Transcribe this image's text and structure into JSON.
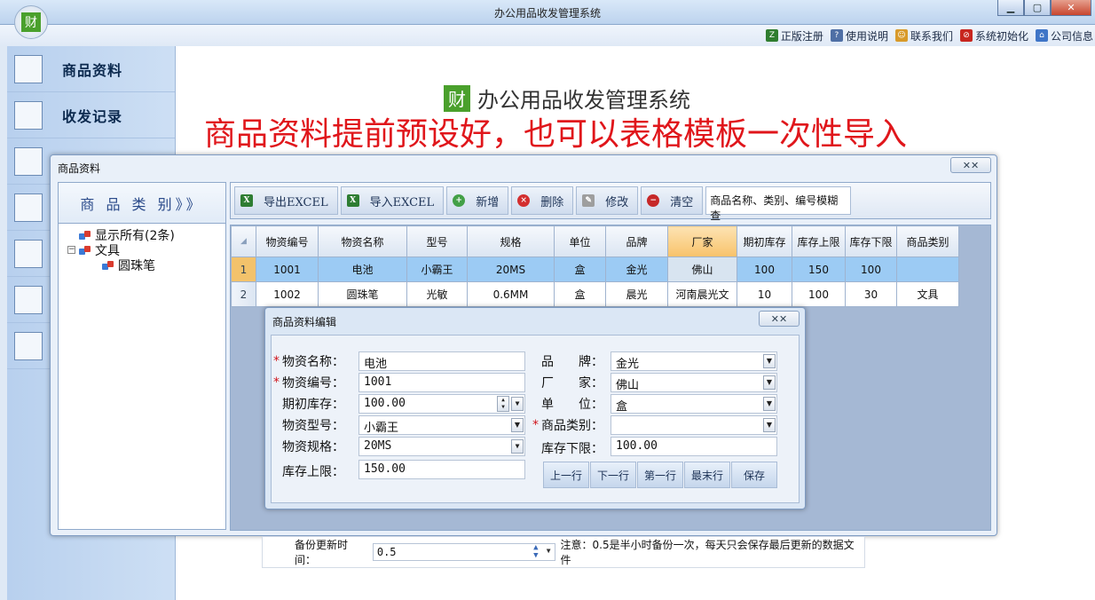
{
  "window": {
    "title": "办公用品收发管理系统",
    "min": "▁",
    "max": "▢",
    "close": "✕",
    "logo_char": "财"
  },
  "toplinks": [
    {
      "label": "正版注册",
      "icon": "register-icon",
      "color": "#2f7d2f",
      "glyph": "Z"
    },
    {
      "label": "使用说明",
      "icon": "book-icon",
      "color": "#4f6fa5",
      "glyph": "?"
    },
    {
      "label": "联系我们",
      "icon": "contact-icon",
      "color": "#d89a2a",
      "glyph": "☺"
    },
    {
      "label": "系统初始化",
      "icon": "reset-icon",
      "color": "#c8261f",
      "glyph": "⊘"
    },
    {
      "label": "公司信息",
      "icon": "company-icon",
      "color": "#3f75c7",
      "glyph": "⌂"
    }
  ],
  "nav": [
    {
      "label": "商品资料",
      "icon": "shop-icon"
    },
    {
      "label": "收发记录",
      "icon": "add-sheet-icon"
    },
    {
      "label": "",
      "icon": "remove-sheet-icon"
    },
    {
      "label": "",
      "icon": "report-icon"
    },
    {
      "label": "",
      "icon": "users-icon"
    },
    {
      "label": "",
      "icon": "document-icon"
    },
    {
      "label": "",
      "icon": "refresh-icon"
    }
  ],
  "brand": {
    "logo_char": "财",
    "title": "办公用品收发管理系统"
  },
  "headline": "商品资料提前预设好，也可以表格模板一次性导入",
  "product_window": {
    "title": "商品资料",
    "close": "✕✕",
    "category_header": "商 品 类 别》》",
    "tree": [
      {
        "label": "显示所有(2条)",
        "level": 0,
        "expander": ""
      },
      {
        "label": "文具",
        "level": 0,
        "expander": "−"
      },
      {
        "label": "圆珠笔",
        "level": 1,
        "expander": ""
      }
    ],
    "toolbar": [
      {
        "label": "导出EXCEL",
        "icon": "excel-icon",
        "color": "#2e7d32",
        "glyph": "X"
      },
      {
        "label": "导入EXCEL",
        "icon": "excel-icon",
        "color": "#2e7d32",
        "glyph": "X"
      },
      {
        "label": "新增",
        "icon": "add-icon",
        "color": "#43a047",
        "glyph": "+"
      },
      {
        "label": "删除",
        "icon": "delete-icon",
        "color": "#d32f2f",
        "glyph": "×"
      },
      {
        "label": "修改",
        "icon": "edit-icon",
        "color": "#9e9e9e",
        "glyph": "✎"
      },
      {
        "label": "清空",
        "icon": "clear-icon",
        "color": "#c62828",
        "glyph": "−"
      }
    ],
    "search_placeholder": "商品名称、类别、编号模糊查",
    "columns": [
      "物资编号",
      "物资名称",
      "型号",
      "规格",
      "单位",
      "品牌",
      "厂家",
      "期初库存",
      "库存上限",
      "库存下限",
      "商品类别"
    ],
    "rows": [
      [
        "1",
        "1001",
        "电池",
        "小霸王",
        "20MS",
        "盒",
        "金光",
        "佛山",
        "100",
        "150",
        "100",
        ""
      ],
      [
        "2",
        "1002",
        "圆珠笔",
        "光敏",
        "0.6MM",
        "盒",
        "晨光",
        "河南晨光文",
        "10",
        "100",
        "30",
        "文具"
      ]
    ]
  },
  "edit_dialog": {
    "title": "商品资料编辑",
    "close": "✕✕",
    "labels": {
      "name": "物资名称：",
      "code": "物资编号：",
      "init_stock": "期初库存：",
      "model": "物资型号：",
      "spec": "物资规格：",
      "max_stock": "库存上限：",
      "brand": "品　　牌：",
      "maker": "厂　　家：",
      "unit": "单　　位：",
      "category": "商品类别：",
      "min_stock": "库存下限："
    },
    "values": {
      "name": "电池",
      "code": "1001",
      "init_stock": "100.00",
      "model": "小霸王",
      "spec": "20MS",
      "max_stock": "150.00",
      "brand": "金光",
      "maker": "佛山",
      "unit": "盒",
      "category": "",
      "min_stock": "100.00"
    },
    "buttons": [
      "上一行",
      "下一行",
      "第一行",
      "最末行",
      "保存"
    ]
  },
  "backup": {
    "label": "备份更新时间：",
    "value": "0.5",
    "note": "注意：0.5是半小时备份一次，每天只会保存最后更新的数据文件"
  }
}
